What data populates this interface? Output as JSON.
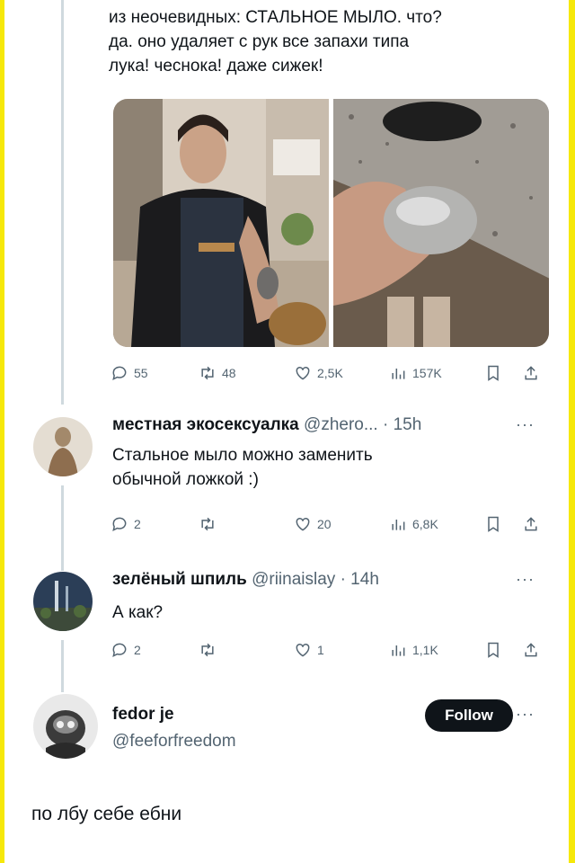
{
  "main_tweet": {
    "text_lines": [
      "из неочевидных: СТАЛЬНОЕ МЫЛО. что?",
      "да. оно удаляет с рук все запахи типа",
      "лука! чеснока! даже сижек!"
    ],
    "actions": {
      "replies": "55",
      "retweets": "48",
      "likes": "2,5K",
      "views": "157K"
    }
  },
  "reply1": {
    "name": "местная экосексуалка",
    "handle": "@zhero...",
    "time": "· 15h",
    "text_lines": [
      "Стальное мыло можно заменить",
      "обычной ложкой :)"
    ],
    "actions": {
      "replies": "2",
      "retweets": "",
      "likes": "20",
      "views": "6,8K"
    }
  },
  "reply2": {
    "name": "зелёный шпиль",
    "handle": "@riinaislay",
    "time": "· 14h",
    "text": "А как?",
    "actions": {
      "replies": "2",
      "retweets": "",
      "likes": "1",
      "views": "1,1K"
    }
  },
  "reply3": {
    "name": "fedor je",
    "handle": "@feeforfreedom",
    "follow_label": "Follow",
    "text": "по лбу себе ебни"
  },
  "more_label": "···",
  "colors": {
    "accent": "#f6e80a",
    "text": "#0f1419",
    "muted": "#536471",
    "line": "#cfd9de"
  }
}
